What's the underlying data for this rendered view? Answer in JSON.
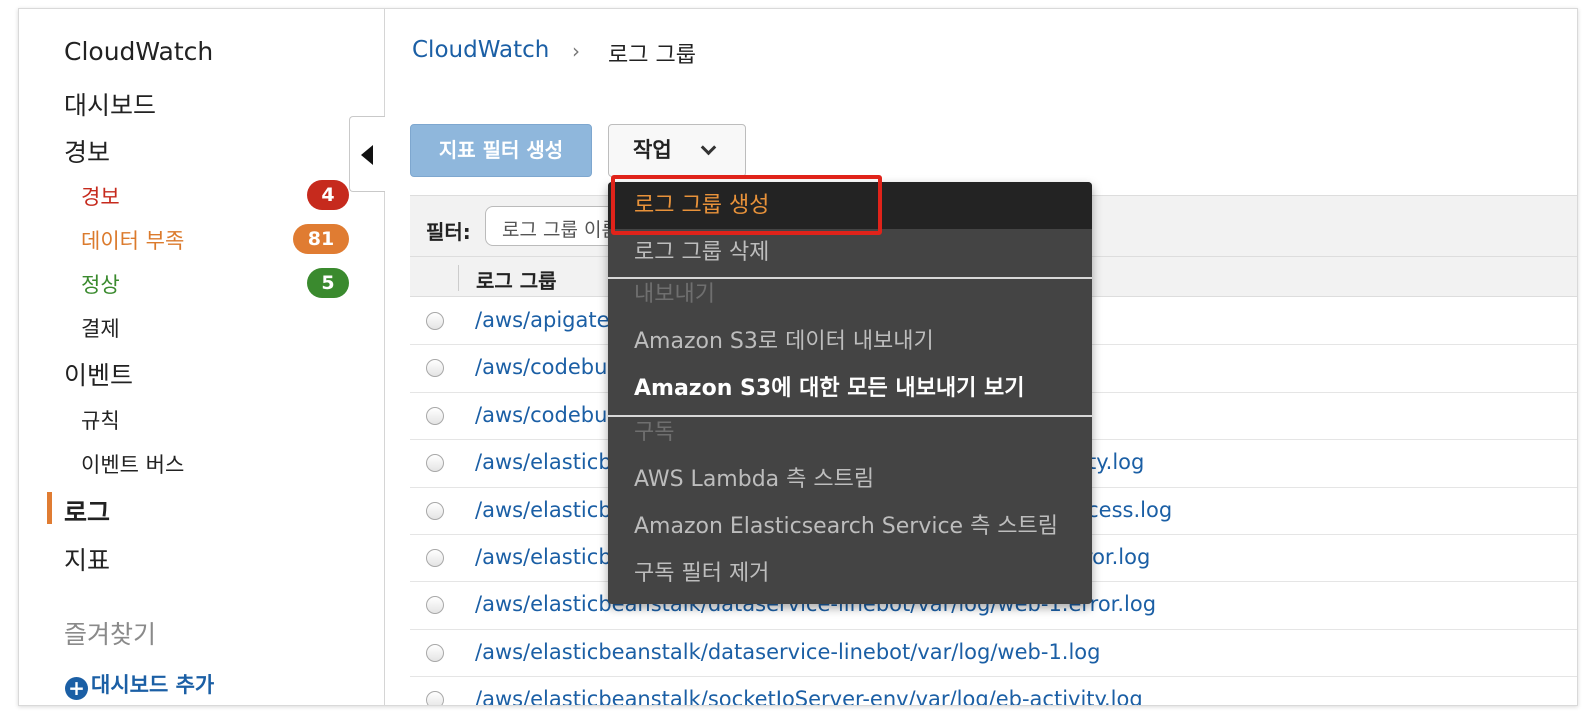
{
  "sidebar": {
    "cloudwatch": "CloudWatch",
    "dashboards": "대시보드",
    "alarms": "경보",
    "alarm_states": [
      {
        "label": "경보",
        "count": "4"
      },
      {
        "label": "데이터 부족",
        "count": "81"
      },
      {
        "label": "정상",
        "count": "5"
      }
    ],
    "billing": "결제",
    "events": "이벤트",
    "rules": "규칙",
    "event_buses": "이벤트 버스",
    "logs": "로그",
    "metrics": "지표",
    "favorites": "즐겨찾기",
    "add_dashboard": "대시보드 추가"
  },
  "breadcrumb": {
    "root": "CloudWatch",
    "separator": "›",
    "current": "로그 그룹"
  },
  "toolbar": {
    "create_metric_filter": "지표 필터 생성",
    "actions": "작업"
  },
  "filter": {
    "label": "필터:",
    "placeholder": "로그 그룹 이름 접두사로 필터링"
  },
  "table": {
    "column_header": "로그 그룹",
    "rows": [
      "/aws/apigateway/welcome",
      "/aws/codebuild/dataservice-linebot",
      "/aws/codebuild/socketIoServer",
      "/aws/elasticbeanstalk/dataservice-linebot/var/log/eb-activity.log",
      "/aws/elasticbeanstalk/dataservice-linebot/var/log/nginx/access.log",
      "/aws/elasticbeanstalk/dataservice-linebot/var/log/nginx/error.log",
      "/aws/elasticbeanstalk/dataservice-linebot/var/log/web-1.error.log",
      "/aws/elasticbeanstalk/dataservice-linebot/var/log/web-1.log",
      "/aws/elasticbeanstalk/socketIoServer-env/var/log/eb-activity.log"
    ]
  },
  "actions_menu": {
    "create_log_group": "로그 그룹 생성",
    "delete_log_group": "로그 그룹 삭제",
    "export_header": "내보내기",
    "export_to_s3": "Amazon S3로 데이터 내보내기",
    "view_all_exports": "Amazon S3에 대한 모든 내보내기 보기",
    "subscription_header": "구독",
    "stream_to_lambda": "AWS Lambda 측 스트림",
    "stream_to_es": "Amazon Elasticsearch Service 측 스트림",
    "remove_subscription_filter": "구독 필터 제거"
  },
  "colors": {
    "link": "#1b5fa5",
    "alarm": "#c62a1d",
    "insufficient": "#e07c32",
    "ok": "#3a8a2e",
    "menu_bg": "#444444",
    "menu_active_text": "#e8923a",
    "highlight": "#e0231a"
  }
}
